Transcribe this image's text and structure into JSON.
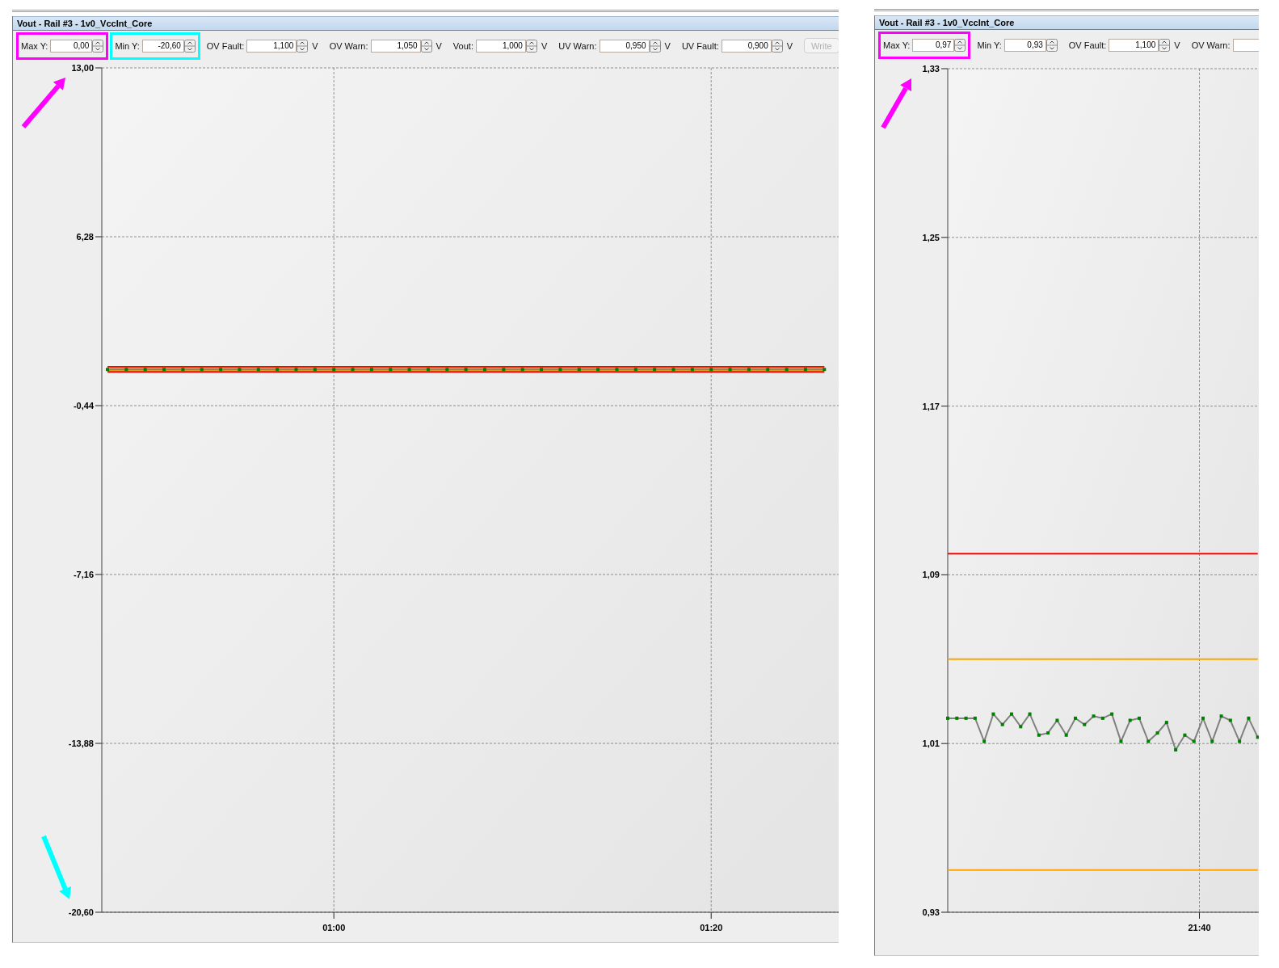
{
  "panels": [
    {
      "title": "Vout - Rail #3 - 1v0_VccInt_Core",
      "toolbar": [
        {
          "kind": "range",
          "label": "Max Y:",
          "value": "0,00",
          "color": "#ff00ff"
        },
        {
          "kind": "range",
          "label": "Min Y:",
          "value": "-20,60",
          "color": "#00ffff"
        },
        {
          "kind": "threshold",
          "label": "OV Fault:",
          "value": "1,100",
          "unit": "V"
        },
        {
          "kind": "threshold",
          "label": "OV Warn:",
          "value": "1,050",
          "unit": "V"
        },
        {
          "kind": "threshold",
          "label": "Vout:",
          "value": "1,000",
          "unit": "V"
        },
        {
          "kind": "threshold",
          "label": "UV Warn:",
          "value": "0,950",
          "unit": "V"
        },
        {
          "kind": "threshold",
          "label": "UV Fault:",
          "value": "0,900",
          "unit": "V"
        }
      ],
      "button": {
        "label": "Write",
        "disabled": true
      },
      "arrows": [
        {
          "kind": "rising",
          "color": "#ff00ff"
        },
        {
          "kind": "falling",
          "color": "#00ffff"
        }
      ],
      "chart_data": {
        "type": "line",
        "grid": true,
        "x": [
          48,
          49,
          50,
          51,
          52,
          53,
          54,
          55,
          56,
          57,
          58,
          59,
          60,
          61,
          62,
          63,
          64,
          65,
          66,
          67,
          68,
          69,
          70,
          71,
          72,
          73,
          74,
          75,
          76,
          77,
          78,
          79,
          80,
          81,
          82,
          83,
          84,
          85,
          86
        ],
        "xlim": [
          47.7,
          86.8
        ],
        "ylim": [
          -20.6,
          13
        ],
        "yticks": [
          {
            "value": 13,
            "label": "13,00"
          },
          {
            "value": 6.28,
            "label": "6,28"
          },
          {
            "value": -0.44,
            "label": "-0,44"
          },
          {
            "value": -7.16,
            "label": "-7,16"
          },
          {
            "value": -13.88,
            "label": "-13,88"
          },
          {
            "value": -20.6,
            "label": "-20,60"
          }
        ],
        "xticks": [
          {
            "value": 60,
            "label": "01:00"
          },
          {
            "value": 80,
            "label": "01:20"
          }
        ],
        "series": [
          {
            "color": "#ff0000",
            "values": [
              1.1,
              1.1,
              1.1,
              1.1,
              1.1,
              1.1,
              1.1,
              1.1,
              1.1,
              1.1,
              1.1,
              1.1,
              1.1,
              1.1,
              1.1,
              1.1,
              1.1,
              1.1,
              1.1,
              1.1,
              1.1,
              1.1,
              1.1,
              1.1,
              1.1,
              1.1,
              1.1,
              1.1,
              1.1,
              1.1,
              1.1,
              1.1,
              1.1,
              1.1,
              1.1,
              1.1,
              1.1,
              1.1,
              1.1
            ]
          },
          {
            "color": "#ffa500",
            "values": [
              1.05,
              1.05,
              1.05,
              1.05,
              1.05,
              1.05,
              1.05,
              1.05,
              1.05,
              1.05,
              1.05,
              1.05,
              1.05,
              1.05,
              1.05,
              1.05,
              1.05,
              1.05,
              1.05,
              1.05,
              1.05,
              1.05,
              1.05,
              1.05,
              1.05,
              1.05,
              1.05,
              1.05,
              1.05,
              1.05,
              1.05,
              1.05,
              1.05,
              1.05,
              1.05,
              1.05,
              1.05,
              1.05,
              1.05
            ]
          },
          {
            "color": "#ffa500",
            "values": [
              0.95,
              0.95,
              0.95,
              0.95,
              0.95,
              0.95,
              0.95,
              0.95,
              0.95,
              0.95,
              0.95,
              0.95,
              0.95,
              0.95,
              0.95,
              0.95,
              0.95,
              0.95,
              0.95,
              0.95,
              0.95,
              0.95,
              0.95,
              0.95,
              0.95,
              0.95,
              0.95,
              0.95,
              0.95,
              0.95,
              0.95,
              0.95,
              0.95,
              0.95,
              0.95,
              0.95,
              0.95,
              0.95,
              0.95
            ]
          },
          {
            "color": "#ff0000",
            "values": [
              0.9,
              0.9,
              0.9,
              0.9,
              0.9,
              0.9,
              0.9,
              0.9,
              0.9,
              0.9,
              0.9,
              0.9,
              0.9,
              0.9,
              0.9,
              0.9,
              0.9,
              0.9,
              0.9,
              0.9,
              0.9,
              0.9,
              0.9,
              0.9,
              0.9,
              0.9,
              0.9,
              0.9,
              0.9,
              0.9,
              0.9,
              0.9,
              0.9,
              0.9,
              0.9,
              0.9,
              0.9,
              0.9,
              0.9
            ]
          },
          {
            "color": "#808080",
            "marker": "square",
            "values": [
              1,
              1,
              1,
              1,
              1,
              1,
              1,
              1,
              1,
              1,
              1,
              1,
              1,
              1,
              1,
              1,
              1,
              1,
              1,
              1,
              1,
              1,
              1,
              1,
              1,
              1,
              1,
              1,
              1,
              1,
              1,
              1,
              1,
              1,
              1,
              1,
              1,
              1,
              1
            ]
          }
        ]
      }
    },
    {
      "title": "Vout - Rail #3 - 1v0_VccInt_Core",
      "toolbar": [
        {
          "kind": "range",
          "label": "Max Y:",
          "value": "0,97",
          "color": "#ff00ff"
        },
        {
          "kind": "range",
          "label": "Min Y:",
          "value": "0,93"
        },
        {
          "kind": "threshold",
          "label": "OV Fault:",
          "value": "1,100",
          "unit": "V"
        },
        {
          "kind": "threshold",
          "label": "OV Warn:"
        }
      ],
      "arrows": [
        {
          "kind": "rising",
          "color": "#ff00ff"
        }
      ],
      "chart_data": {
        "type": "line",
        "grid": true,
        "ylim": [
          0.93,
          1.33
        ],
        "yticks": [
          {
            "value": 1.33,
            "label": "1,33"
          },
          {
            "value": 1.25,
            "label": "1,25"
          },
          {
            "value": 1.17,
            "label": "1,17"
          },
          {
            "value": 1.09,
            "label": "1,09"
          },
          {
            "value": 1.01,
            "label": "1,01"
          },
          {
            "value": 0.93,
            "label": "0,93"
          }
        ],
        "annotations": [
          "21:40"
        ],
        "series": [
          {
            "color": "#ff0000",
            "values": [
              1.1,
              1.1,
              1.1,
              1.1,
              1.1,
              1.1,
              1.1,
              1.1,
              1.1,
              1.1,
              1.1,
              1.1,
              1.1,
              1.1,
              1.1,
              1.1,
              1.1,
              1.1,
              1.1,
              1.1,
              1.1,
              1.1,
              1.1,
              1.1,
              1.1,
              1.1,
              1.1,
              1.1,
              1.1,
              1.1,
              1.1,
              1.1,
              1.1,
              1.1,
              1.1
            ]
          },
          {
            "color": "#ffa500",
            "values": [
              1.05,
              1.05,
              1.05,
              1.05,
              1.05,
              1.05,
              1.05,
              1.05,
              1.05,
              1.05,
              1.05,
              1.05,
              1.05,
              1.05,
              1.05,
              1.05,
              1.05,
              1.05,
              1.05,
              1.05,
              1.05,
              1.05,
              1.05,
              1.05,
              1.05,
              1.05,
              1.05,
              1.05,
              1.05,
              1.05,
              1.05,
              1.05,
              1.05,
              1.05,
              1.05
            ]
          },
          {
            "color": "#ffa500",
            "values": [
              0.95,
              0.95,
              0.95,
              0.95,
              0.95,
              0.95,
              0.95,
              0.95,
              0.95,
              0.95,
              0.95,
              0.95,
              0.95,
              0.95,
              0.95,
              0.95,
              0.95,
              0.95,
              0.95,
              0.95,
              0.95,
              0.95,
              0.95,
              0.95,
              0.95,
              0.95,
              0.95,
              0.95,
              0.95,
              0.95,
              0.95,
              0.95,
              0.95,
              0.95,
              0.95
            ]
          },
          {
            "color": "#808080",
            "marker": "square",
            "values": [
              1.022,
              1.022,
              1.022,
              1.022,
              1.011,
              1.024,
              1.019,
              1.024,
              1.018,
              1.024,
              1.014,
              1.015,
              1.021,
              1.014,
              1.022,
              1.019,
              1.023,
              1.022,
              1.024,
              1.011,
              1.021,
              1.022,
              1.011,
              1.015,
              1.02,
              1.007,
              1.014,
              1.011,
              1.022,
              1.011,
              1.023,
              1.021,
              1.011,
              1.022,
              1.013
            ]
          }
        ]
      }
    }
  ]
}
